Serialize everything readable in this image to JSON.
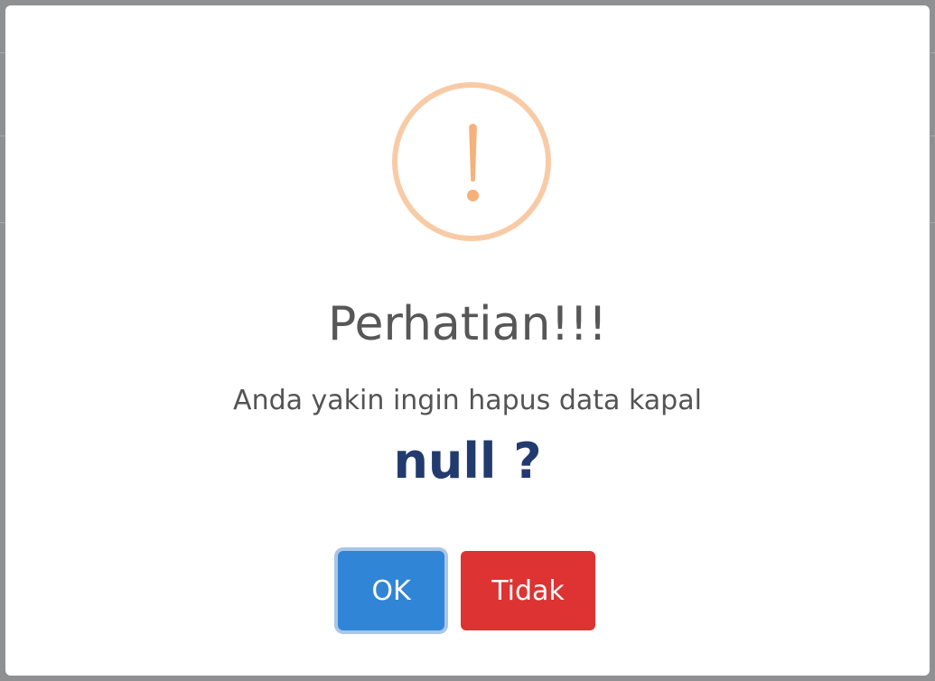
{
  "dialog": {
    "title": "Perhatian!!!",
    "message": "Anda yakin ingin hapus data kapal",
    "highlight": "null ?",
    "icon": "warning-icon",
    "confirm_label": "OK",
    "cancel_label": "Tidak"
  },
  "colors": {
    "confirm": "#3085d6",
    "cancel": "#dd3333",
    "warning": "#f8bb86",
    "highlight_text": "#223b6e"
  }
}
